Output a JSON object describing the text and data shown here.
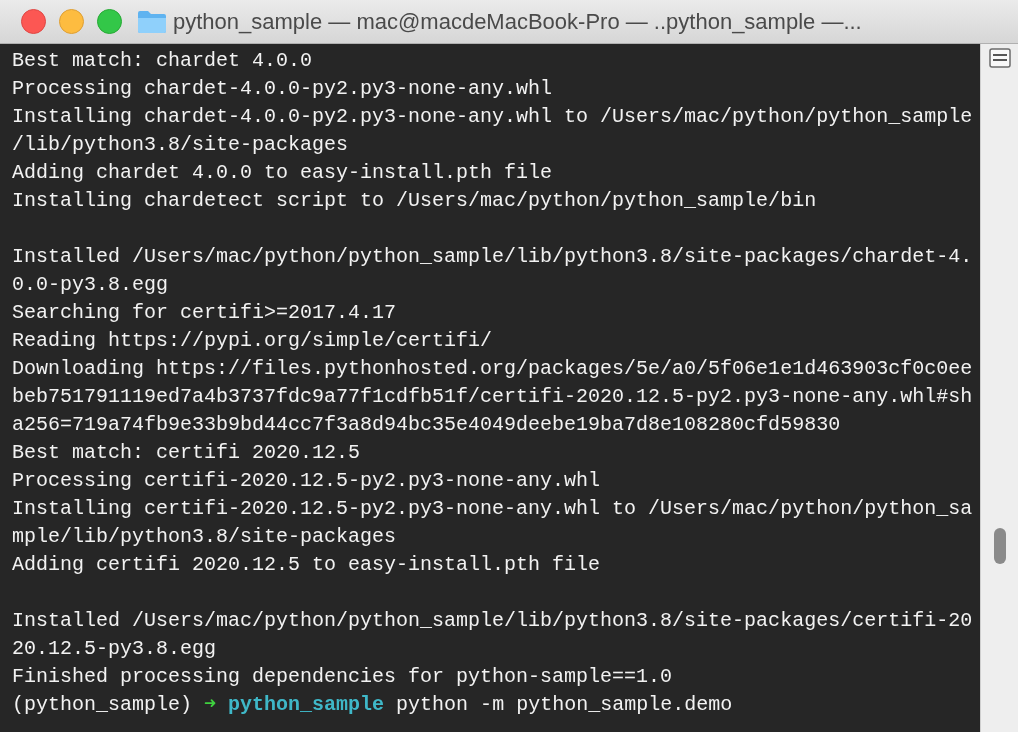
{
  "window": {
    "title": "python_sample — mac@macdeMacBook-Pro — ..python_sample —..."
  },
  "lines": [
    {
      "kind": "output",
      "text": "Best match: chardet 4.0.0"
    },
    {
      "kind": "output",
      "text": "Processing chardet-4.0.0-py2.py3-none-any.whl"
    },
    {
      "kind": "output",
      "text": "Installing chardet-4.0.0-py2.py3-none-any.whl to /Users/mac/python/python_sample"
    },
    {
      "kind": "output",
      "text": "/lib/python3.8/site-packages"
    },
    {
      "kind": "output",
      "text": "Adding chardet 4.0.0 to easy-install.pth file"
    },
    {
      "kind": "output",
      "text": "Installing chardetect script to /Users/mac/python/python_sample/bin"
    },
    {
      "kind": "blank"
    },
    {
      "kind": "output",
      "text": "Installed /Users/mac/python/python_sample/lib/python3.8/site-packages/chardet-4."
    },
    {
      "kind": "output",
      "text": "0.0-py3.8.egg"
    },
    {
      "kind": "output",
      "text": "Searching for certifi>=2017.4.17"
    },
    {
      "kind": "output",
      "text": "Reading https://pypi.org/simple/certifi/"
    },
    {
      "kind": "output",
      "text": "Downloading https://files.pythonhosted.org/packages/5e/a0/5f06e1e1d463903cf0c0ee"
    },
    {
      "kind": "output",
      "text": "beb751791119ed7a4b3737fdc9a77f1cdfb51f/certifi-2020.12.5-py2.py3-none-any.whl#sh"
    },
    {
      "kind": "output",
      "text": "a256=719a74fb9e33b9bd44cc7f3a8d94bc35e4049deebe19ba7d8e108280cfd59830"
    },
    {
      "kind": "output",
      "text": "Best match: certifi 2020.12.5"
    },
    {
      "kind": "output",
      "text": "Processing certifi-2020.12.5-py2.py3-none-any.whl"
    },
    {
      "kind": "output",
      "text": "Installing certifi-2020.12.5-py2.py3-none-any.whl to /Users/mac/python/python_sa"
    },
    {
      "kind": "output",
      "text": "mple/lib/python3.8/site-packages"
    },
    {
      "kind": "output",
      "text": "Adding certifi 2020.12.5 to easy-install.pth file"
    },
    {
      "kind": "blank"
    },
    {
      "kind": "output",
      "text": "Installed /Users/mac/python/python_sample/lib/python3.8/site-packages/certifi-20"
    },
    {
      "kind": "output",
      "text": "20.12.5-py3.8.egg"
    },
    {
      "kind": "output",
      "text": "Finished processing dependencies for python-sample==1.0"
    }
  ],
  "prompt": {
    "env": "(python_sample)",
    "arrow": "➜",
    "directory": "python_sample",
    "command": "python -m python_sample.demo"
  }
}
